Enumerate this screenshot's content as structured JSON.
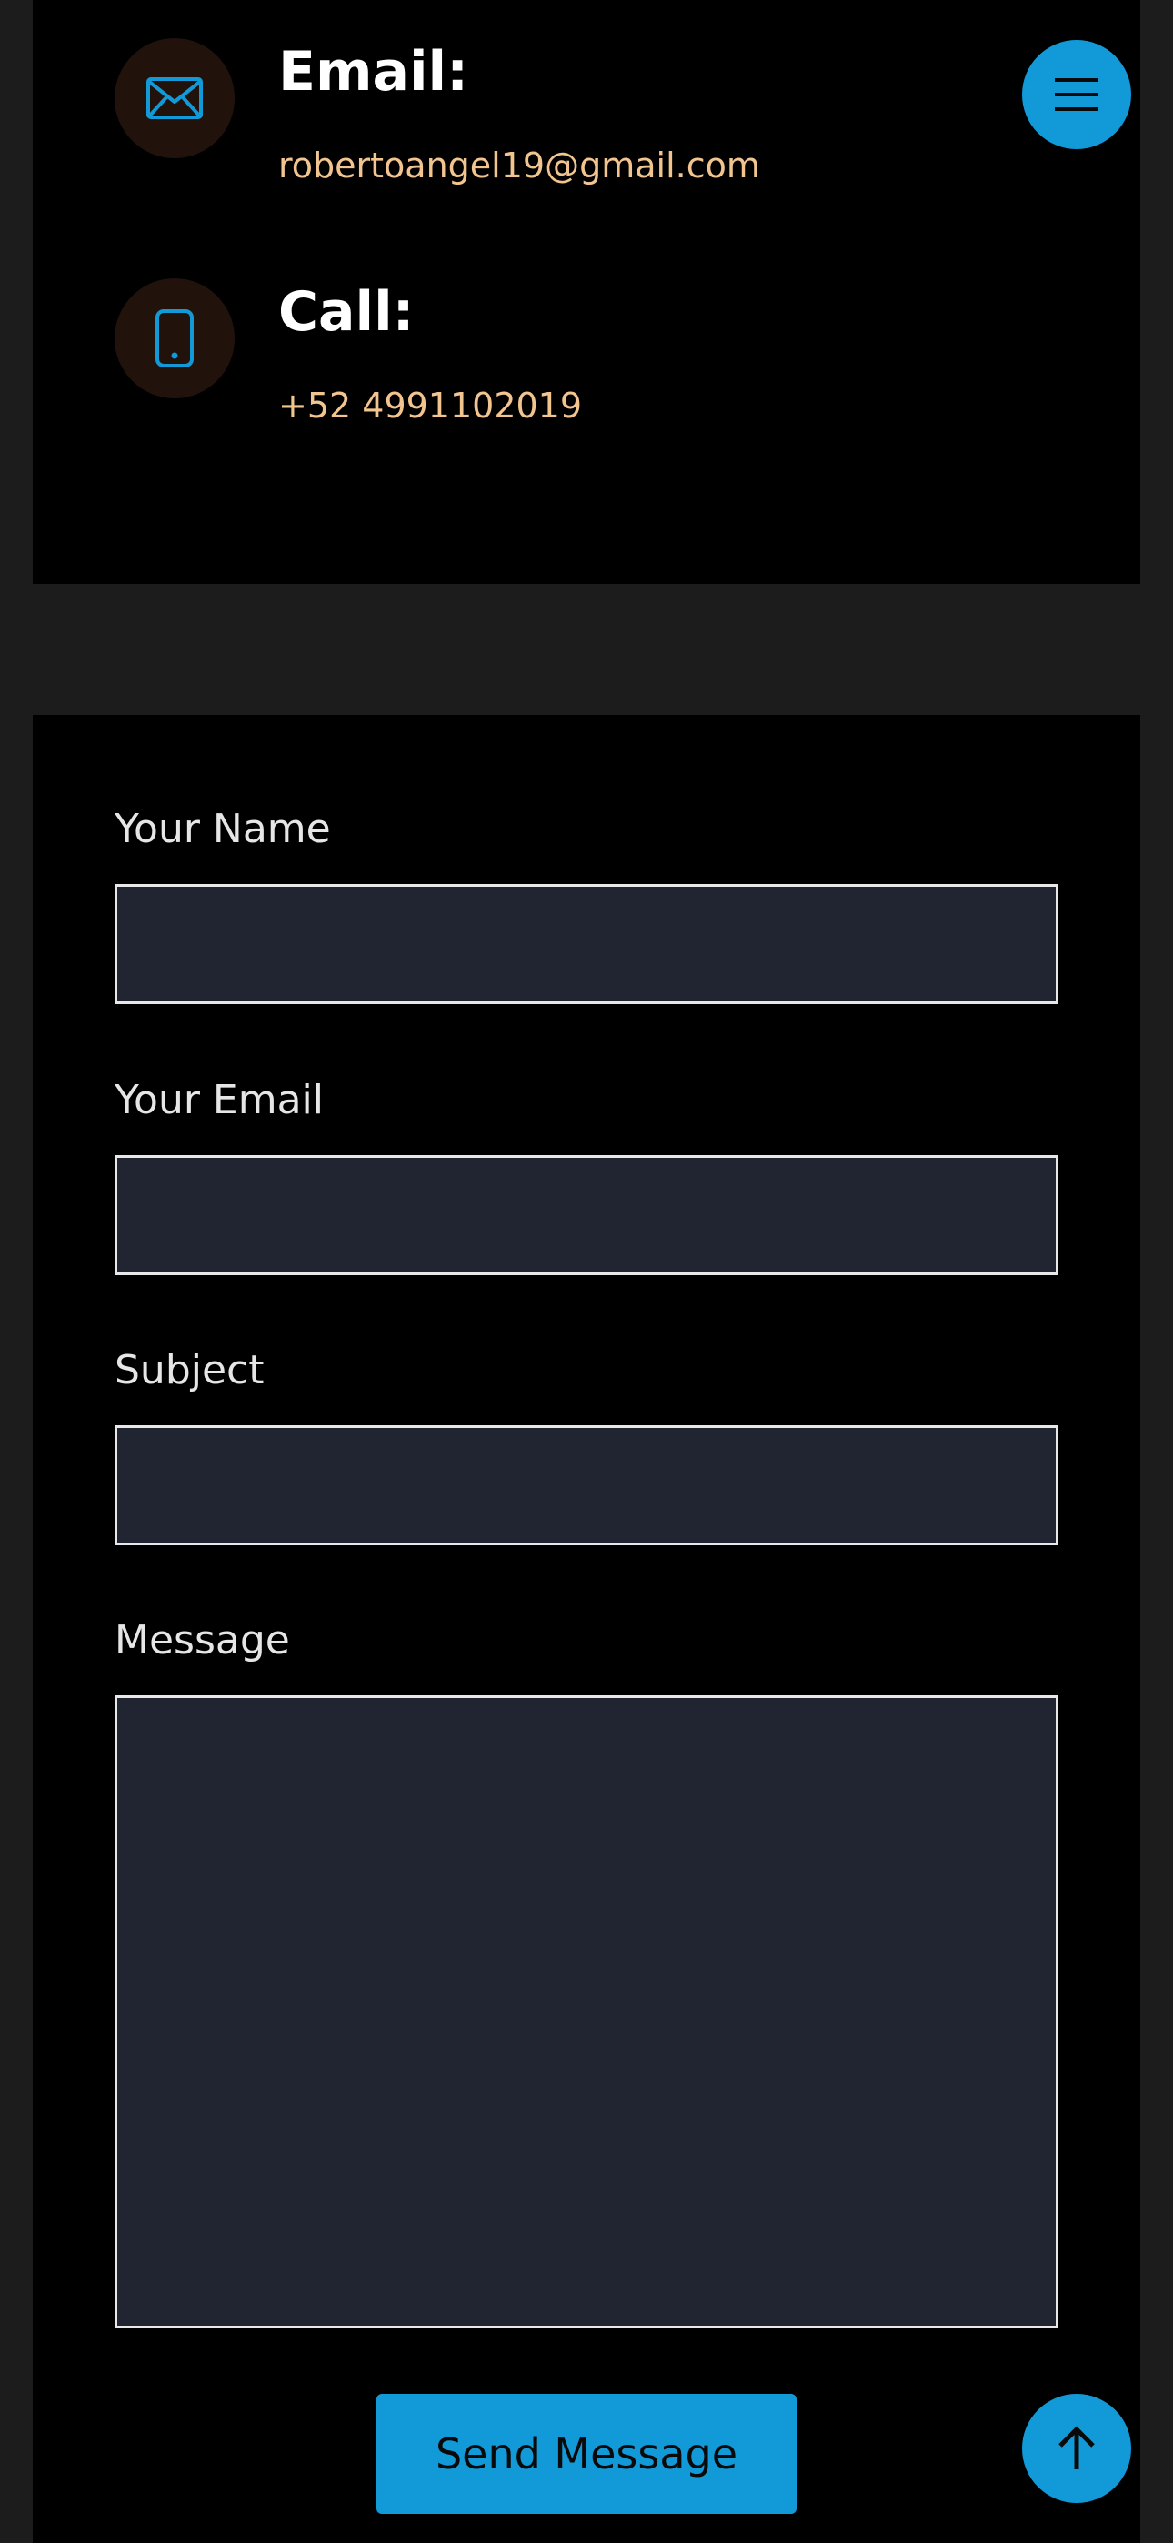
{
  "contact_info": {
    "email": {
      "title": "Email:",
      "value": "robertoangel19@gmail.com",
      "icon": "envelope-icon"
    },
    "call": {
      "title": "Call:",
      "value": "+52 4991102019",
      "icon": "phone-icon"
    }
  },
  "form": {
    "name_label": "Your Name",
    "name_value": "",
    "email_label": "Your Email",
    "email_value": "",
    "subject_label": "Subject",
    "subject_value": "",
    "message_label": "Message",
    "message_value": "",
    "send_label": "Send Message"
  },
  "controls": {
    "menu_icon": "hamburger-menu-icon",
    "top_icon": "arrow-up-icon"
  },
  "colors": {
    "accent": "#129ad8",
    "value_text": "#f2c48f",
    "icon_circle": "#22120c",
    "field_bg": "#212532",
    "panel_bg": "#000000",
    "page_bg": "#1c1c1c"
  }
}
